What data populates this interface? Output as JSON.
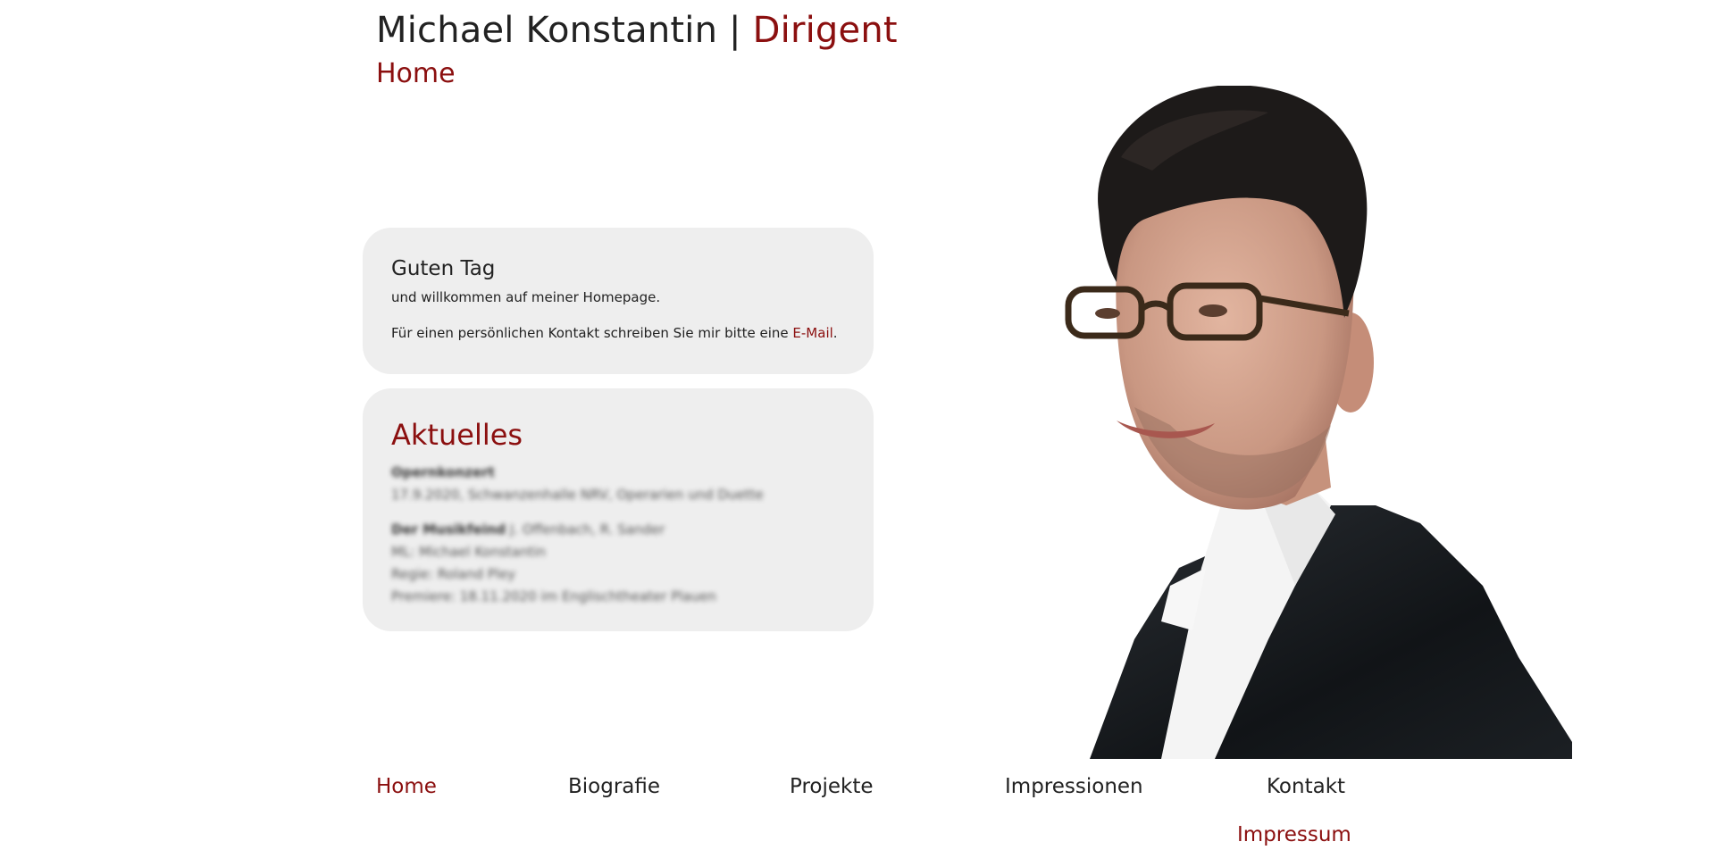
{
  "header": {
    "name": "Michael Konstantin",
    "separator": "|",
    "role": "Dirigent",
    "page_title": "Home"
  },
  "welcome": {
    "heading": "Guten Tag",
    "line1": "und willkommen auf meiner Homepage.",
    "line2_prefix": "Für einen persönlichen Kontakt schreiben Sie mir bitte eine ",
    "email_link": "E-Mail",
    "line2_suffix": "."
  },
  "news": {
    "heading": "Aktuelles",
    "entries": [
      {
        "title": "Opernkonzert",
        "lines": [
          "17.9.2020, Schwanzenhalle NRV, Operarien und Duette"
        ]
      },
      {
        "title": "Der Musikfeind",
        "title_suffix": " J. Offenbach, R. Sander",
        "lines": [
          "ML: Michael Konstantin",
          "Regie: Roland Pley",
          "Premiere: 18.11.2020 im Englischtheater Plauen"
        ]
      }
    ]
  },
  "portrait": {
    "alt": "Portrait des Dirigenten Michael Konstantin"
  },
  "nav": {
    "items": [
      {
        "label": "Home",
        "active": true
      },
      {
        "label": "Biografie",
        "active": false
      },
      {
        "label": "Projekte",
        "active": false
      },
      {
        "label": "Impressionen",
        "active": false
      },
      {
        "label": "Kontakt",
        "active": false
      }
    ],
    "impressum": "Impressum"
  },
  "colors": {
    "accent": "#8b0f0f",
    "text": "#222222",
    "card_bg": "#eeeeee"
  }
}
